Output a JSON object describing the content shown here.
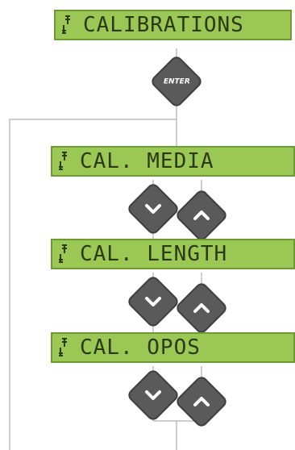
{
  "menu": {
    "items": [
      {
        "label": "CALIBRATIONS"
      },
      {
        "label": "CAL. MEDIA"
      },
      {
        "label": "CAL. LENGTH"
      },
      {
        "label": "CAL. OPOS"
      }
    ]
  },
  "buttons": {
    "enter_label": "ENTER"
  },
  "colors": {
    "lcd_background": "#9bc755",
    "lcd_text": "#2b3a14",
    "button_background": "#5a5a5a",
    "connector_line": "#bdbdbd"
  },
  "icons": {
    "scroll": "up-down-arrows-icon",
    "down": "chevron-down-icon",
    "up": "chevron-up-icon"
  }
}
